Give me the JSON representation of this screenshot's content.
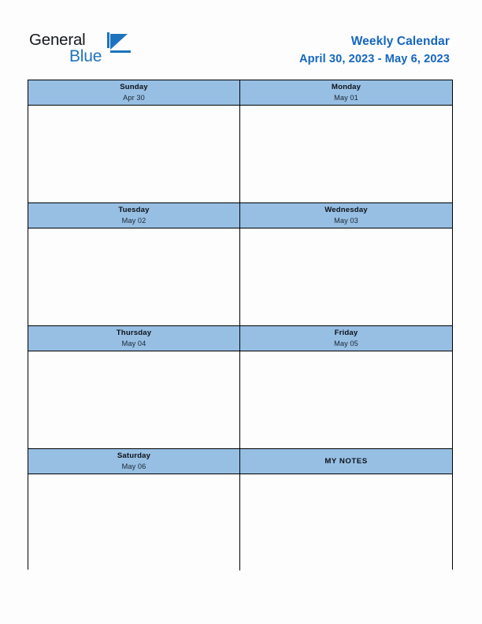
{
  "brand": {
    "word_one": "General",
    "word_two": "Blue",
    "triangle_icon": "brand-triangle-icon",
    "accent_color": "#1f73be",
    "text_color": "#15181c"
  },
  "header": {
    "title": "Weekly Calendar",
    "date_range": "April 30, 2023 - May 6, 2023",
    "title_color": "#1466c0"
  },
  "calendar": {
    "header_fill": "#97bfe4",
    "cell_fill": "#fdfdfd",
    "border_color": "#000000",
    "rows": [
      {
        "left": {
          "day": "Sunday",
          "date": "Apr 30"
        },
        "right": {
          "day": "Monday",
          "date": "May 01"
        }
      },
      {
        "left": {
          "day": "Tuesday",
          "date": "May 02"
        },
        "right": {
          "day": "Wednesday",
          "date": "May 03"
        }
      },
      {
        "left": {
          "day": "Thursday",
          "date": "May 04"
        },
        "right": {
          "day": "Friday",
          "date": "May 05"
        }
      },
      {
        "left": {
          "day": "Saturday",
          "date": "May 06"
        },
        "right": {
          "notes_label": "MY NOTES"
        }
      }
    ]
  }
}
